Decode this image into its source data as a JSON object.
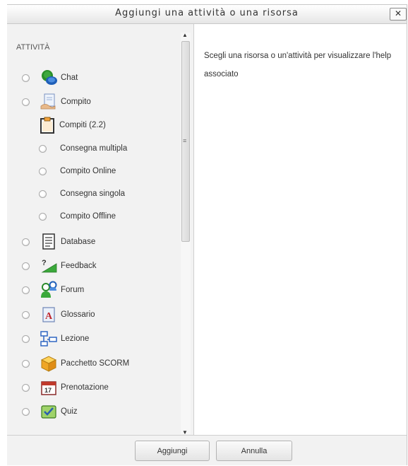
{
  "dialog": {
    "title": "Aggiungi una attività o una risorsa",
    "close_label": "✕"
  },
  "left": {
    "section_title": "ATTIVITÀ",
    "items": [
      {
        "label": "Chat",
        "icon": "chat-icon",
        "has_radio": true
      },
      {
        "label": "Compito",
        "icon": "assignment-icon",
        "has_radio": true
      },
      {
        "label": "Compiti (2.2)",
        "icon": "assignment-group-icon",
        "has_radio": false
      },
      {
        "label": "Consegna multipla",
        "icon": null,
        "has_radio": true
      },
      {
        "label": "Compito Online",
        "icon": null,
        "has_radio": true
      },
      {
        "label": "Consegna singola",
        "icon": null,
        "has_radio": true
      },
      {
        "label": "Compito Offline",
        "icon": null,
        "has_radio": true
      },
      {
        "label": "Database",
        "icon": "database-icon",
        "has_radio": true
      },
      {
        "label": "Feedback",
        "icon": "feedback-icon",
        "has_radio": true
      },
      {
        "label": "Forum",
        "icon": "forum-icon",
        "has_radio": true
      },
      {
        "label": "Glossario",
        "icon": "glossary-icon",
        "has_radio": true
      },
      {
        "label": "Lezione",
        "icon": "lesson-icon",
        "has_radio": true
      },
      {
        "label": "Pacchetto SCORM",
        "icon": "scorm-icon",
        "has_radio": true
      },
      {
        "label": "Prenotazione",
        "icon": "calendar-icon",
        "has_radio": true
      },
      {
        "label": "Quiz",
        "icon": "quiz-icon",
        "has_radio": true
      }
    ]
  },
  "right": {
    "help_text": "Scegli una risorsa o un'attività per visualizzare l'help associato"
  },
  "footer": {
    "add_label": "Aggiungi",
    "cancel_label": "Annulla"
  },
  "colors": {
    "panel_bg": "#f2f2f2",
    "border": "#cfcfcf"
  }
}
